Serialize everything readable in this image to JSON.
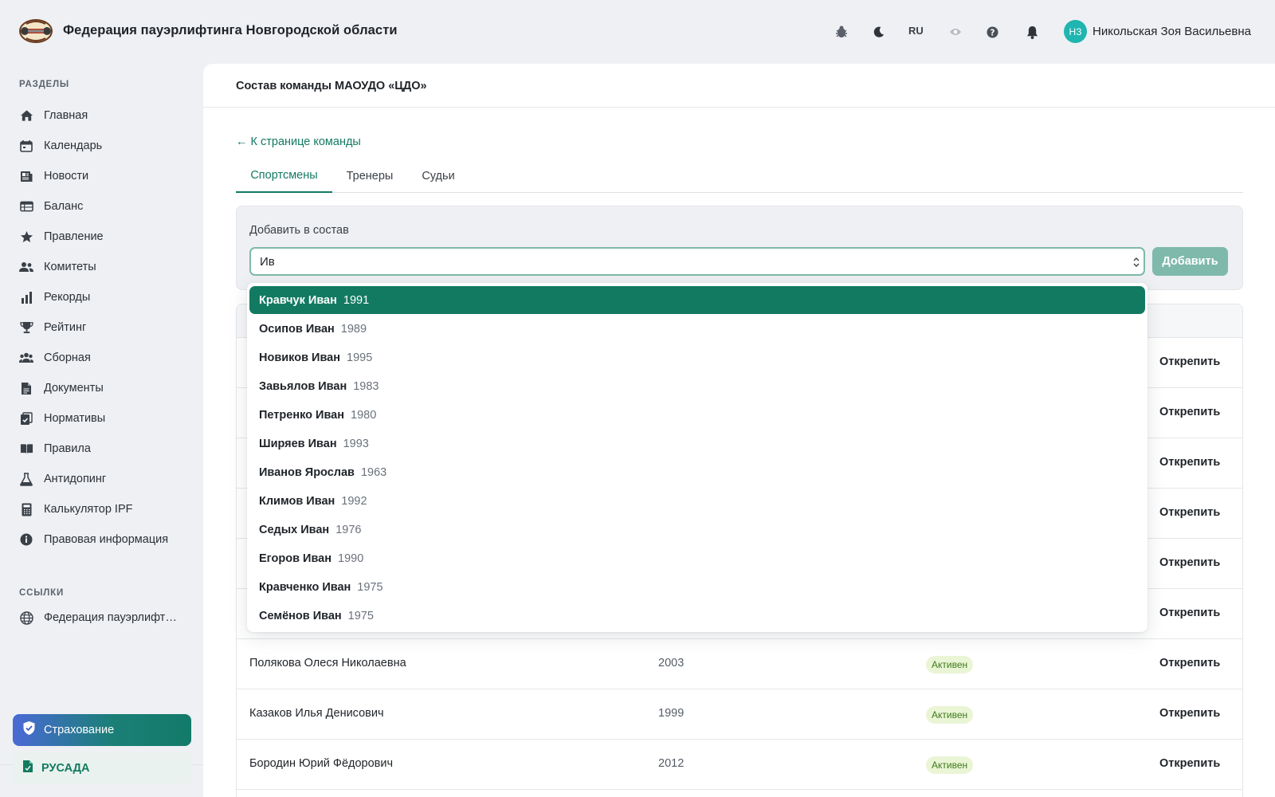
{
  "header": {
    "org_title": "Федерация пауэрлифтинга Новгородской области",
    "language": "RU",
    "avatar_initials": "НЗ",
    "user_name": "Никольская Зоя Васильевна",
    "icons": [
      "bug-icon",
      "moon-icon",
      "eye-icon",
      "help-icon",
      "bell-icon"
    ]
  },
  "sidebar": {
    "sections_heading": "РАЗДЕЛЫ",
    "items": [
      {
        "label": "Главная",
        "icon": "home-icon"
      },
      {
        "label": "Календарь",
        "icon": "calendar-icon"
      },
      {
        "label": "Новости",
        "icon": "newspaper-icon"
      },
      {
        "label": "Баланс",
        "icon": "table-icon"
      },
      {
        "label": "Правление",
        "icon": "star-icon"
      },
      {
        "label": "Комитеты",
        "icon": "users-icon"
      },
      {
        "label": "Рекорды",
        "icon": "bar-chart-icon"
      },
      {
        "label": "Рейтинг",
        "icon": "trophy-icon"
      },
      {
        "label": "Сборная",
        "icon": "team-icon"
      },
      {
        "label": "Документы",
        "icon": "document-icon"
      },
      {
        "label": "Нормативы",
        "icon": "clipboard-icon"
      },
      {
        "label": "Правила",
        "icon": "book-icon"
      },
      {
        "label": "Антидопинг",
        "icon": "flask-icon"
      },
      {
        "label": "Калькулятор IPF",
        "icon": "calculator-icon"
      },
      {
        "label": "Правовая информация",
        "icon": "info-icon"
      }
    ],
    "links_heading": "ССЫЛКИ",
    "links": [
      {
        "label": "Федерация пауэрлифтинга Новгородской области",
        "icon": "globe-icon"
      }
    ],
    "insurance_label": "Страхование",
    "rusada_label": "РУСАДА"
  },
  "main": {
    "title": "Состав команды МАОУДО «ЦДО»",
    "back_link": "← К странице команды",
    "tabs": [
      {
        "label": "Спортсмены",
        "active": true
      },
      {
        "label": "Тренеры",
        "active": false
      },
      {
        "label": "Судьи",
        "active": false
      }
    ],
    "add_box": {
      "label": "Добавить в состав",
      "input_value": "Ив",
      "button_label": "Добавить"
    },
    "dropdown": [
      {
        "name": "Кравчук Иван",
        "year": "1991",
        "selected": true
      },
      {
        "name": "Осипов Иван",
        "year": "1989"
      },
      {
        "name": "Новиков Иван",
        "year": "1995"
      },
      {
        "name": "Завьялов Иван",
        "year": "1983"
      },
      {
        "name": "Петренко Иван",
        "year": "1980"
      },
      {
        "name": "Ширяев Иван",
        "year": "1993"
      },
      {
        "name": "Иванов Ярослав",
        "year": "1963"
      },
      {
        "name": "Климов Иван",
        "year": "1992"
      },
      {
        "name": "Седых Иван",
        "year": "1976"
      },
      {
        "name": "Егоров Иван",
        "year": "1990"
      },
      {
        "name": "Кравченко Иван",
        "year": "1975"
      },
      {
        "name": "Семёнов Иван",
        "year": "1975"
      }
    ],
    "rows": [
      {
        "name": "",
        "year": "",
        "status": "",
        "action": "Открепить"
      },
      {
        "name": "",
        "year": "",
        "status": "",
        "action": "Открепить"
      },
      {
        "name": "",
        "year": "",
        "status": "",
        "action": "Открепить"
      },
      {
        "name": "",
        "year": "",
        "status": "",
        "action": "Открепить"
      },
      {
        "name": "",
        "year": "",
        "status": "",
        "action": "Открепить"
      },
      {
        "name": "",
        "year": "",
        "status": "",
        "action": "Открепить"
      },
      {
        "name": "Полякова Олеся Николаевна",
        "year": "2003",
        "status": "Активен",
        "action": "Открепить"
      },
      {
        "name": "Казаков Илья Денисович",
        "year": "1999",
        "status": "Активен",
        "action": "Открепить"
      },
      {
        "name": "Бородин Юрий Фёдорович",
        "year": "2012",
        "status": "Активен",
        "action": "Открепить"
      }
    ]
  },
  "colors": {
    "accent": "#137a62",
    "avatar": "#1fb5b0",
    "status_bg": "#eaf5d6",
    "status_text": "#3e7a1c"
  }
}
